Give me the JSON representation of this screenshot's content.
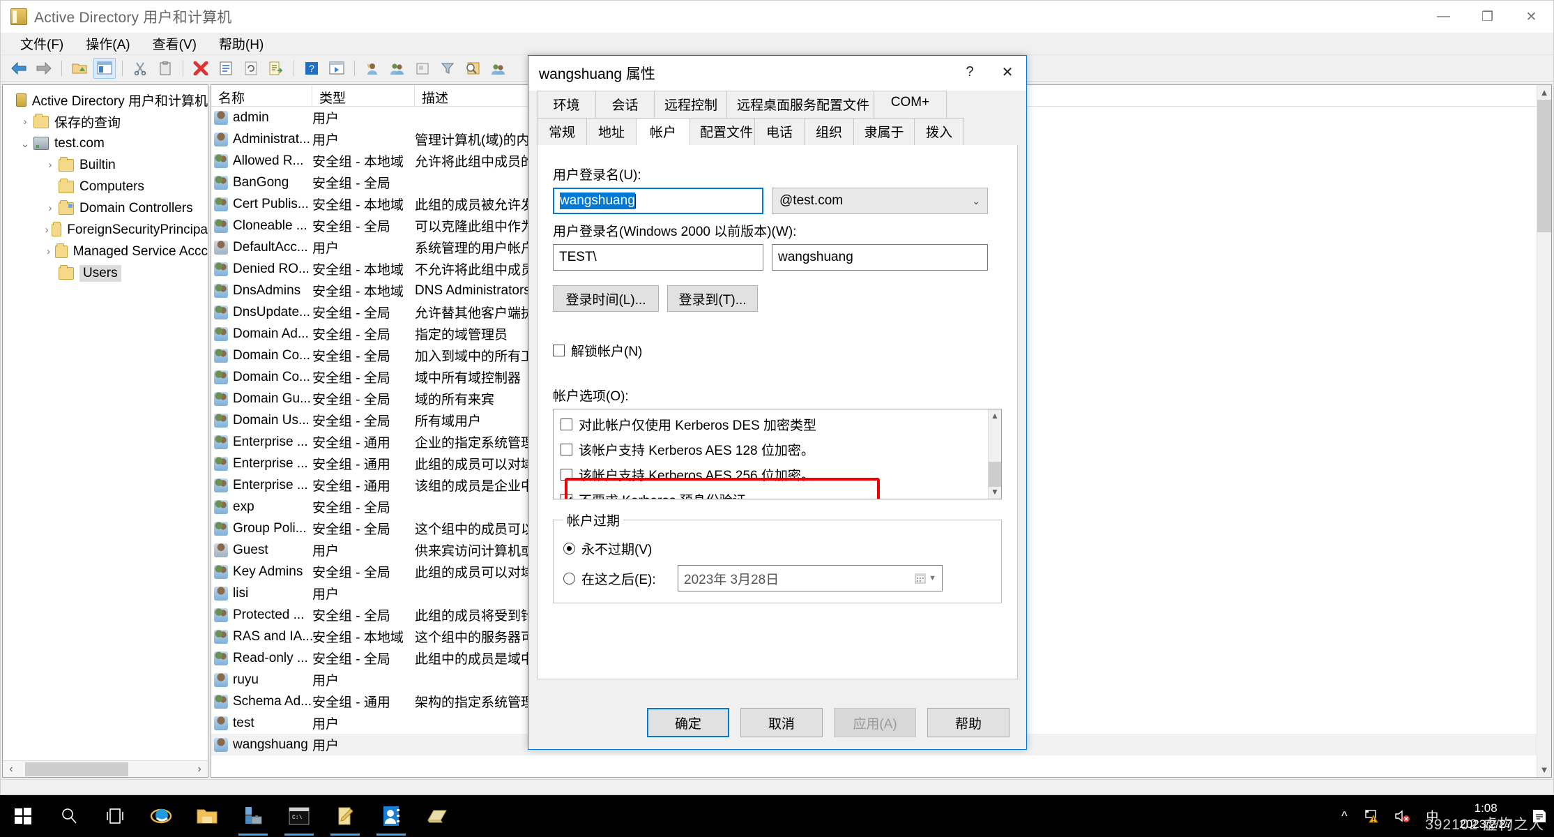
{
  "window": {
    "title": "Active Directory 用户和计算机",
    "minimize": "—",
    "maximize": "❐",
    "close": "✕"
  },
  "menubar": [
    "文件(F)",
    "操作(A)",
    "查看(V)",
    "帮助(H)"
  ],
  "toolbar_icons": [
    "back-icon",
    "forward-icon",
    "up-folder-icon",
    "show-hide-tree-icon",
    "cut-icon",
    "paste-icon",
    "delete-icon",
    "properties-icon",
    "refresh-icon",
    "export-list-icon",
    "help-icon",
    "show-console-tree-icon",
    "new-user-icon",
    "new-group-icon",
    "new-contact-icon",
    "filter-icon",
    "find-icon",
    "add-member-icon"
  ],
  "tree": {
    "root": "Active Directory 用户和计算机",
    "items": [
      {
        "label": "保存的查询",
        "depth": 1,
        "expander": "›",
        "icon": "folder-icon",
        "selected": false
      },
      {
        "label": "test.com",
        "depth": 1,
        "expander": "⌄",
        "icon": "server-icon",
        "selected": false
      },
      {
        "label": "Builtin",
        "depth": 2,
        "expander": "›",
        "icon": "folder-icon",
        "selected": false
      },
      {
        "label": "Computers",
        "depth": 2,
        "expander": "",
        "icon": "folder-icon",
        "selected": false
      },
      {
        "label": "Domain Controllers",
        "depth": 2,
        "expander": "›",
        "icon": "folder-ou-icon",
        "selected": false
      },
      {
        "label": "ForeignSecurityPrincipa",
        "depth": 2,
        "expander": "›",
        "icon": "folder-icon",
        "selected": false
      },
      {
        "label": "Managed Service Accc",
        "depth": 2,
        "expander": "›",
        "icon": "folder-icon",
        "selected": false
      },
      {
        "label": "Users",
        "depth": 2,
        "expander": "",
        "icon": "folder-icon",
        "selected": true
      }
    ]
  },
  "list": {
    "columns": [
      "名称",
      "类型",
      "描述"
    ],
    "rows": [
      {
        "name": "admin",
        "type": "用户",
        "desc": "",
        "icon": "user-icon"
      },
      {
        "name": "Administrat...",
        "type": "用户",
        "desc": "管理计算机(域)的内",
        "icon": "user-icon"
      },
      {
        "name": "Allowed R...",
        "type": "安全组 - 本地域",
        "desc": "允许将此组中成员的",
        "icon": "group-icon"
      },
      {
        "name": "BanGong",
        "type": "安全组 - 全局",
        "desc": "",
        "icon": "group-icon"
      },
      {
        "name": "Cert Publis...",
        "type": "安全组 - 本地域",
        "desc": "此组的成员被允许发",
        "icon": "group-icon"
      },
      {
        "name": "Cloneable ...",
        "type": "安全组 - 全局",
        "desc": "可以克隆此组中作为",
        "icon": "group-icon"
      },
      {
        "name": "DefaultAcc...",
        "type": "用户",
        "desc": "系统管理的用户帐户",
        "icon": "user-disabled-icon"
      },
      {
        "name": "Denied RO...",
        "type": "安全组 - 本地域",
        "desc": "不允许将此组中成员",
        "icon": "group-icon"
      },
      {
        "name": "DnsAdmins",
        "type": "安全组 - 本地域",
        "desc": "DNS Administrators",
        "icon": "group-icon"
      },
      {
        "name": "DnsUpdate...",
        "type": "安全组 - 全局",
        "desc": "允许替其他客户端执",
        "icon": "group-icon"
      },
      {
        "name": "Domain Ad...",
        "type": "安全组 - 全局",
        "desc": "指定的域管理员",
        "icon": "group-icon"
      },
      {
        "name": "Domain Co...",
        "type": "安全组 - 全局",
        "desc": "加入到域中的所有工",
        "icon": "group-icon"
      },
      {
        "name": "Domain Co...",
        "type": "安全组 - 全局",
        "desc": "域中所有域控制器",
        "icon": "group-icon"
      },
      {
        "name": "Domain Gu...",
        "type": "安全组 - 全局",
        "desc": "域的所有来宾",
        "icon": "group-icon"
      },
      {
        "name": "Domain Us...",
        "type": "安全组 - 全局",
        "desc": "所有域用户",
        "icon": "group-icon"
      },
      {
        "name": "Enterprise ...",
        "type": "安全组 - 通用",
        "desc": "企业的指定系统管理",
        "icon": "group-icon"
      },
      {
        "name": "Enterprise ...",
        "type": "安全组 - 通用",
        "desc": "此组的成员可以对域",
        "icon": "group-icon"
      },
      {
        "name": "Enterprise ...",
        "type": "安全组 - 通用",
        "desc": "该组的成员是企业中",
        "icon": "group-icon"
      },
      {
        "name": "exp",
        "type": "安全组 - 全局",
        "desc": "",
        "icon": "group-icon"
      },
      {
        "name": "Group Poli...",
        "type": "安全组 - 全局",
        "desc": "这个组中的成员可以",
        "icon": "group-icon"
      },
      {
        "name": "Guest",
        "type": "用户",
        "desc": "供来宾访问计算机或",
        "icon": "user-disabled-icon"
      },
      {
        "name": "Key Admins",
        "type": "安全组 - 全局",
        "desc": "此组的成员可以对域",
        "icon": "group-icon"
      },
      {
        "name": "lisi",
        "type": "用户",
        "desc": "",
        "icon": "user-icon"
      },
      {
        "name": "Protected ...",
        "type": "安全组 - 全局",
        "desc": "此组的成员将受到针",
        "icon": "group-icon"
      },
      {
        "name": "RAS and IA...",
        "type": "安全组 - 本地域",
        "desc": "这个组中的服务器可",
        "icon": "group-icon"
      },
      {
        "name": "Read-only ...",
        "type": "安全组 - 全局",
        "desc": "此组中的成员是域中",
        "icon": "group-icon"
      },
      {
        "name": "ruyu",
        "type": "用户",
        "desc": "",
        "icon": "user-icon"
      },
      {
        "name": "Schema Ad...",
        "type": "安全组 - 通用",
        "desc": "架构的指定系统管理",
        "icon": "group-icon"
      },
      {
        "name": "test",
        "type": "用户",
        "desc": "",
        "icon": "user-icon"
      },
      {
        "name": "wangshuang",
        "type": "用户",
        "desc": "",
        "icon": "user-icon",
        "selected": true
      }
    ]
  },
  "dialog": {
    "title": "wangshuang 属性",
    "help_btn": "?",
    "close_btn": "✕",
    "tabs_row1": [
      "环境",
      "会话",
      "远程控制",
      "远程桌面服务配置文件",
      "COM+"
    ],
    "tabs_row2": [
      "常规",
      "地址",
      "帐户",
      "配置文件",
      "电话",
      "组织",
      "隶属于",
      "拨入"
    ],
    "active_tab": "帐户",
    "logon_name_label": "用户登录名(U):",
    "logon_name_value": "wangshuang",
    "upn_suffix": "@test.com",
    "pre2000_label": "用户登录名(Windows 2000 以前版本)(W):",
    "pre2000_domain": "TEST\\",
    "pre2000_value": "wangshuang",
    "logon_hours_btn": "登录时间(L)...",
    "logon_to_btn": "登录到(T)...",
    "unlock_label": "解锁帐户(N)",
    "unlock_checked": false,
    "options_label": "帐户选项(O):",
    "options": [
      {
        "label": "对此帐户仅使用 Kerberos DES 加密类型",
        "checked": false,
        "highlighted": false
      },
      {
        "label": "该帐户支持 Kerberos AES 128 位加密。",
        "checked": false,
        "highlighted": false
      },
      {
        "label": "该帐户支持 Kerberos AES 256 位加密。",
        "checked": false,
        "highlighted": false
      },
      {
        "label": "不要求 Kerberos 预身份验证",
        "checked": true,
        "highlighted": true
      }
    ],
    "highlight_color": "#ee0000",
    "expiry_legend": "帐户过期",
    "expiry_never": "永不过期(V)",
    "expiry_end_of": "在这之后(E):",
    "expiry_never_selected": true,
    "expiry_date": "2023年  3月28日",
    "footer": {
      "ok": "确定",
      "cancel": "取消",
      "apply": "应用(A)",
      "help": "帮助",
      "apply_disabled": true
    }
  },
  "taskbar": {
    "start_icon": "windows-start-icon",
    "items": [
      "search-icon",
      "task-view-icon",
      "internet-explorer-icon",
      "file-explorer-icon",
      "server-manager-icon",
      "command-prompt-icon",
      "notepad-icon",
      "ad-users-computers-icon",
      "powershell-icon"
    ],
    "tray": {
      "chevron": "^",
      "network_icon": "network-warning-icon",
      "volume_icon": "volume-muted-icon",
      "ime": "中",
      "time": "1:08",
      "date": "2023/2/27",
      "watermark": "392102 虚构之人"
    }
  }
}
